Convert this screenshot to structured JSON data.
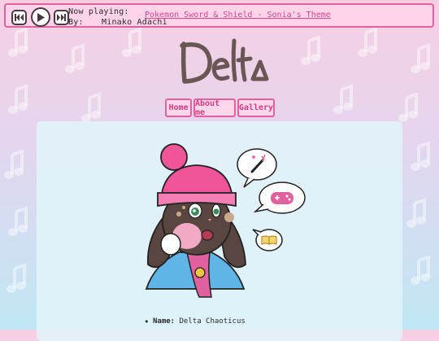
{
  "player": {
    "now_playing_label": "Now playing:",
    "track": "Pokemon Sword & Shield - Sonia's Theme",
    "by_label": "By:",
    "artist": "Minako Adachi",
    "icons": [
      "previous-icon",
      "play-icon",
      "next-icon"
    ]
  },
  "logo": {
    "text": "Delta"
  },
  "nav": [
    {
      "label": "Home"
    },
    {
      "label": "About me"
    },
    {
      "label": "Gallery"
    }
  ],
  "profile": {
    "name_label": "Name:",
    "name": "Delta Chaoticus"
  },
  "colors": {
    "accent": "#e0619e",
    "player_bg": "#ffd3ea",
    "logo": "#6b5656",
    "gradient_top": "#f7cfe3",
    "gradient_bottom": "#bfe7f5"
  }
}
